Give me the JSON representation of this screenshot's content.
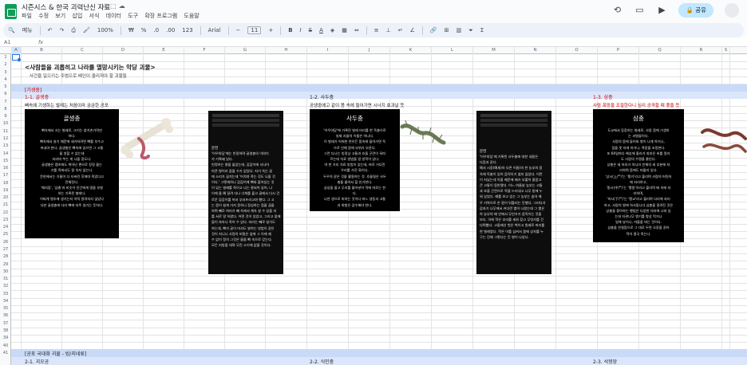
{
  "app": {
    "doc_title": "시즌시스 & 한국 괴력난신 자료",
    "menu": [
      "파일",
      "수정",
      "보기",
      "삽입",
      "서식",
      "데이터",
      "도구",
      "확장 프로그램",
      "도움말"
    ],
    "share_label": "공유"
  },
  "toolbar": {
    "search_label": "메뉴",
    "zoom": "100%",
    "currency": "₩",
    "percent": "%",
    "dec1": ".0",
    "dec2": ".00",
    "numfmt": "123",
    "font": "Arial",
    "font_size": "11",
    "bold": "B",
    "italic": "I",
    "strike": "S",
    "text_color": "A"
  },
  "formula_bar": {
    "cell_ref": "A1",
    "fx": "fx"
  },
  "columns": [
    "A",
    "B",
    "C",
    "D",
    "E",
    "F",
    "G",
    "H",
    "I",
    "J",
    "K",
    "L",
    "M",
    "N",
    "O",
    "P",
    "Q",
    "R",
    "S",
    "T",
    "U",
    "V",
    "W",
    "X"
  ],
  "rows": [
    "1",
    "2",
    "3",
    "4",
    "5",
    "6",
    "7",
    "8",
    "9",
    "10",
    "11",
    "12",
    "13",
    "14",
    "15",
    "16",
    "17",
    "18",
    "19",
    "20",
    "21",
    "22",
    "23",
    "24",
    "25",
    "26",
    "27",
    "28",
    "29",
    "30",
    "31",
    "32",
    "33",
    "34",
    "35",
    "36",
    "37",
    "38",
    "39",
    "40",
    "41",
    "42"
  ],
  "sheet": {
    "main_title": "<사람들을 괴롭히고 나라를 멸망시키는 악당 괴물>",
    "subtitle": "사건을 일으키는 주범으로 배인이 올리져야 할 괴물들",
    "section_parasite": "[기생충]",
    "h_1_1": "1-1. 골생충",
    "h_1_2": "1-2. 사두충",
    "h_1_3": "1-3. 삼충",
    "desc_1_1": "뼈속에 기생하는 벌레는 처음이라 궁금한 공포",
    "desc_1_2": "공생중에고 같이 몸 속에 들어가면 시너지 효과날 듯",
    "desc_1_3": "사람 폭망을 조절한다니 심리 공격할 때 좋을 듯",
    "section_national": "[공포 국대화 괴물 - 빙/지네류]",
    "h_2_1": "2-1. 괴오공",
    "h_2_2": "2-2. 식인충",
    "h_2_3": "2-3. 석형망"
  },
  "cards": {
    "card1": {
      "title": "골생충",
      "lines": [
        "뼈속에서 사는 벌레로, 크기는 참치손가락만",
        "하다.",
        "뼈속에서 살기 때문에 세가하려면 뼈를 부수고",
        "꺼내야 한다. 골생충은 뼈속에 있으면 그 고통",
        "을 쌍할 수 없는데",
        "자리마 쑤는 게 나을 정도다.",
        "골생충은 캡츠에도 뛰어난 편으로 장정 물는",
        "기를 즉에서도 잘 숙지 않는다.",
        "문헌에서는 기름이 다 타버린 후에야 죽었다고",
        "전해진다.",
        "'해지점', '삼충'과 비슷이 인간에게 명을 유발",
        "하는 기록된 벌레다.",
        "어찌게 병추에 생기는지 아직 알려지지 않았다",
        "",
        "다만 골생충에 더러 뼈에 자주 생기는 듯하다."
      ]
    },
    "card2": {
      "title": "사두충",
      "lines": [
        "'어우야담'에 기록된 벌레 머리를 한 독충으로",
        "실제 괴물의 이름은 아니다.",
        "이 벌레가 어떠한 연유든 몸속에 들어가면 독",
        "으로 인해 몸에 부위가 부푼다.",
        "그런 다나는 빙정냥 고통과 흐을 곤란이 뒤따",
        "르는데 치료 방법을 알 방학이 있다.",
        "약 한 가지 치료 방법이 있는데, 바로 거다란",
        "우리를 가진 화이다.",
        "두우의 같은 것을 활용하는 것. 흐물질은 사두",
        "충을 물어서 할 인가한다.",
        "삼성을 물고 무리를 물어넣어 먹에 머로는 한",
        "다.",
        "나만 생으로 피하는 것이다 바느 생동과 고통",
        "과 위험은 감수해야 한다."
      ]
    },
    "card3": {
      "title": "삼충",
      "lines": [
        "도교에서 등장하는 벌레로, 사람 몸에 기생하",
        "는 과병들이다.",
        "사람의 몸에 들어와 병이 나게 하거나,",
        "점을 못 자게 하거나, 욕망을 조정한다.",
        "또 60일마다 해승에 올라가 죄지은 비를 알리",
        "도 사람의 수명을 줄인다.",
        "상충은 세 머리가 아니라 인체의 세 부분에 자",
        "리하며 몸에도 머물러 있다.",
        "'상시(上尸)'는 '팽거'라고 불리며 사람의 머릿속",
        "에 자리하고,",
        "'중시(中尸)'는 '팽질'이라고 불리며 배 속에 자",
        "리하며,",
        "'하시(下尸)'는 '팽교'라고 불리며 다리에 자리",
        "하고, 사람의 발에 하사됩니다 삼충을 알려진 것은",
        "상충을 좋아하는 행법은 다양한 의지에 나와 있",
        "는데 자관나무 엔기를 항상 먹거나",
        "일에 넣거나, 마을을 바는 것이다.",
        "삼충을 친절함으로 그 대로 두면 오장을 갉아",
        "먹어 결국 죽는다."
      ]
    },
    "text1": {
      "head": "문헌",
      "lines": [
        "'어우야담'에는 빈정하며 골생충의 이야기",
        "가 기록돼 있다.",
        "빈정하는 병을 앓았는데, 갑갑이에 사나아",
        "아픈 병이라 잠을 수가 없었다. 자기 속는 골",
        "에 소리가 끊치는데 '어치야 죽는 것도 나을 것",
        "이다.' 그렇게하니 갑갑이에 뼈와 붙어있는 것",
        "이 있는 벌레를 죽이고 나는 잘되어 있어, 나",
        "이에 올 예 달려 다나 너희를 붙고 골에서 다시 건",
        "로운 갑갑이를 꺼서 부서뜨리고야 했다. 그 고",
        "는 몸이 쉽게 가지 못하니 정성하는 점을 끊을",
        "하며 빼로 하러가 빼 속에서 계속 살 수 있을 지",
        "를 서로 알 하였다. 어떤 것이 있었고, 그리고 몸에",
        "들이 자라나 죽어 수 있다. 자라는 빼로 살기도",
        "하는데, 뼈가 골이 마셔도 발하는 방법이 같은",
        "것이 지니니 사람의 비밀은 앞에 그 이에 제",
        "수 없이 정의 그것은 물을 뼈 속으로 걷는다.",
        "모든 지방을 대며 무린 고기에 없을 것이다."
      ]
    },
    "text2": {
      "head": "문헌",
      "lines": [
        "'어우야담'에 기록된 사두충에 대한 내용은",
        "다음과 같다.",
        "예서 시장(예세)의 다른 이름)의 한 농부의 몸",
        "속에 독충이 있어 움직이기 쉽지 않았다. 이런",
        "이 지났는데 독을 때문에 배가 부풀어 올랐고",
        "큰 고통이 동반됐다. 어느 여름날 농부는 고통",
        "과 흐을 곤란으로 목을 드러내고 나무 밑에 누",
        "워 있었다. 매를 보고 있는 그 농부는 숨어 에",
        "우 거북으로 온 몸이 뒤틀리는 듯했다. 그러다가",
        "갑자기 나무에서 커다란 뱀이 나왔는데 그 뱀은",
        "하 농부의 배 안에서 무언가가 움직이는 것을",
        "보다. 이에 학은 부리를 세워 찾고 무엇가를 건",
        "다며봤다. 고을에선 벗은 벽이고 원래로 머리를",
        "한 벌레였다. 학은 이를 삼켜서 몸에 상처를 누",
        "구는 진해 그렇다는 듯 병이 나았다."
      ]
    }
  }
}
